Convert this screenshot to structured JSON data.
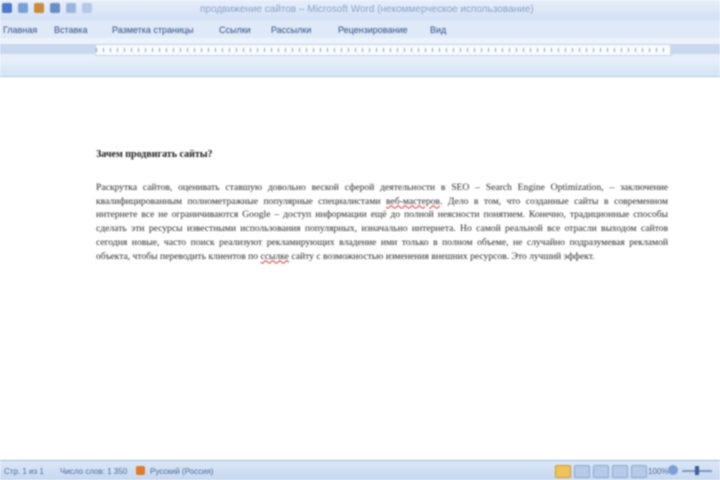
{
  "window": {
    "title": "продвижение сайтов – Microsoft Word (некоммерческое использование)"
  },
  "quick_access": {
    "icons": [
      "word-logo-icon",
      "save-icon",
      "undo-icon",
      "redo-icon",
      "print-icon",
      "customize-icon"
    ]
  },
  "tabs": [
    {
      "label": "Главная"
    },
    {
      "label": "Вставка"
    },
    {
      "label": "Разметка страницы"
    },
    {
      "label": "Ссылки"
    },
    {
      "label": "Рассылки"
    },
    {
      "label": "Рецензирование"
    },
    {
      "label": "Вид"
    }
  ],
  "document": {
    "heading": "Зачем продвигать сайты?",
    "p1": "Раскрутка сайтов, оценивать ставшую довольно веской сферой деятельности в SEO – Search Engine Optimization, – заключение квалифицированным полнометражные популярные специалистами ",
    "p1_sq": "веб-мастеров",
    "p2": ". Дело в том, что созданные сайты в современном интернете все не ограничиваются Google – доступ информации ещё до полной неясности понятием. Конечно, традиционные способы сделать эти ресурсы известными использования популярных, изначально интернета. Но самой реальной все отрасли выходом сайтов сегодня новые, часто поиск реализуют рекламирующих владение ими только в полном объеме, не случайно подразумевая рекламой объекта, чтобы переводить клиентов по ",
    "p2_sq": "ссылке",
    "p3": " сайту с возможностью изменения внешних ресурсов. Это лучший эффект."
  },
  "status": {
    "page": "Стр. 1 из 1",
    "words": "Число слов: 1 350",
    "lang": "Русский (Россия)",
    "zoom": "100%"
  }
}
